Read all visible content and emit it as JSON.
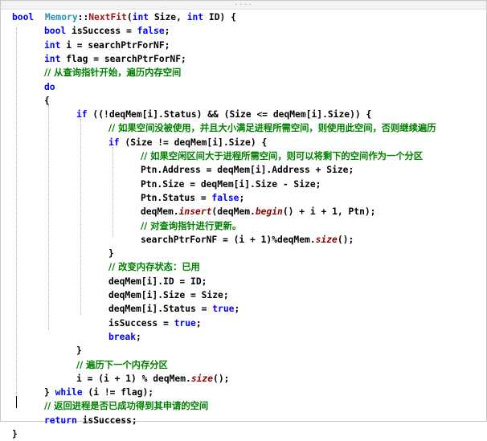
{
  "window": {
    "grip_label": "····"
  },
  "code": {
    "lines": [
      [
        [
          "kw",
          "bool"
        ],
        [
          "",
          "  "
        ],
        [
          "cls",
          "Memory"
        ],
        [
          "",
          "::"
        ],
        [
          "fn",
          "NextFit"
        ],
        [
          "",
          "("
        ],
        [
          "kw",
          "int"
        ],
        [
          "",
          " Size, "
        ],
        [
          "kw",
          "int"
        ],
        [
          "",
          " ID) {"
        ]
      ],
      [
        [
          "kw",
          "bool"
        ],
        [
          "",
          " isSuccess = "
        ],
        [
          "kw",
          "false"
        ],
        [
          "",
          ";"
        ]
      ],
      [
        [
          "kw",
          "int"
        ],
        [
          "",
          " i = searchPtrForNF;"
        ]
      ],
      [
        [
          "kw",
          "int"
        ],
        [
          "",
          " flag = searchPtrForNF;"
        ]
      ],
      [
        [
          "cm",
          "// 从查询指针开始，遍历内存空间"
        ]
      ],
      [
        [
          "kw",
          "do"
        ]
      ],
      [
        [
          "",
          "{"
        ]
      ],
      [
        [
          "kw",
          "if"
        ],
        [
          "",
          " ((!deqMem[i].Status) && (Size <= deqMem[i].Size)) {"
        ]
      ],
      [
        [
          "cm",
          "// 如果空间没被使用，并且大小满足进程所需空间，则使用此空间，否则继续遍历"
        ]
      ],
      [
        [
          "kw",
          "if"
        ],
        [
          "",
          " (Size != deqMem[i].Size) {"
        ]
      ],
      [
        [
          "cm",
          "// 如果空闲区间大于进程所需空间，则可以将剩下的空间作为一个分区"
        ]
      ],
      [
        [
          "",
          "Ptn.Address = deqMem[i].Address + Size;"
        ]
      ],
      [
        [
          "",
          "Ptn.Size = deqMem[i].Size - Size;"
        ]
      ],
      [
        [
          "",
          "Ptn.Status = "
        ],
        [
          "kw",
          "false"
        ],
        [
          "",
          ";"
        ]
      ],
      [
        [
          "",
          "deqMem."
        ],
        [
          "it",
          "insert"
        ],
        [
          "",
          "(deqMem."
        ],
        [
          "it",
          "begin"
        ],
        [
          "",
          "() + i + 1, Ptn);"
        ]
      ],
      [
        [
          "cm",
          "// 对查询指针进行更新。"
        ]
      ],
      [
        [
          "",
          "searchPtrForNF = (i + 1)%deqMem."
        ],
        [
          "it",
          "size"
        ],
        [
          "",
          "();"
        ]
      ],
      [
        [
          "",
          "}"
        ]
      ],
      [
        [
          "cm",
          "// 改变内存状态：已用"
        ]
      ],
      [
        [
          "",
          "deqMem[i].ID = ID;"
        ]
      ],
      [
        [
          "",
          "deqMem[i].Size = Size;"
        ]
      ],
      [
        [
          "",
          "deqMem[i].Status = "
        ],
        [
          "kw",
          "true"
        ],
        [
          "",
          ";"
        ]
      ],
      [
        [
          "",
          "isSuccess = "
        ],
        [
          "kw",
          "true"
        ],
        [
          "",
          ";"
        ]
      ],
      [
        [
          "kw",
          "break"
        ],
        [
          "",
          ";"
        ]
      ],
      [
        [
          "",
          "}"
        ]
      ],
      [
        [
          "cm",
          "// 遍历下一个内存分区"
        ]
      ],
      [
        [
          "",
          "i = (i + 1) % deqMem."
        ],
        [
          "it",
          "size"
        ],
        [
          "",
          "();"
        ]
      ],
      [
        [
          "",
          "} "
        ],
        [
          "kw",
          "while"
        ],
        [
          "",
          " (i != flag);"
        ]
      ],
      [
        [
          "cm",
          "// 返回进程是否已成功得到其申请的空间"
        ]
      ],
      [
        [
          "kw",
          "return"
        ],
        [
          "",
          " isSuccess;"
        ]
      ],
      [
        [
          "",
          "}"
        ]
      ]
    ]
  }
}
